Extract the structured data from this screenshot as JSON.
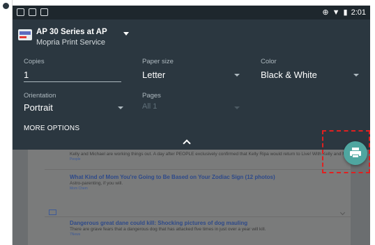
{
  "status_bar": {
    "time": "2:01",
    "left_icons": [
      "notification-icon",
      "notification-icon",
      "notification-icon"
    ],
    "right_icons": [
      "sync-icon",
      "wifi-icon",
      "battery-icon"
    ]
  },
  "printer": {
    "name": "AP 30 Series at AP",
    "service": "Mopria Print Service"
  },
  "options": {
    "copies_label": "Copies",
    "copies_value": "1",
    "paper_size_label": "Paper size",
    "paper_size_value": "Letter",
    "color_label": "Color",
    "color_value": "Black & White",
    "orientation_label": "Orientation",
    "orientation_value": "Portrait",
    "pages_label": "Pages",
    "pages_value": "All 1"
  },
  "more_options_label": "MORE OPTIONS",
  "preview": {
    "articles": [
      {
        "title": "",
        "body": "Kelly and Michael are working things out. A day after PEOPLE exclusively confirmed that Kelly Ripa would return to Live! With Kelly and Michael' after a nearly weeklong absence, a source says Michael Strahan is excited to have her",
        "tag": "People"
      },
      {
        "title": "What Kind of Mom You're Going to Be Based on Your Zodiac Sign (12 photos)",
        "body": "Astro-parenting, if you will.",
        "tag": "Mom Chem"
      },
      {
        "title": "Dangerous great dane could kill: Shocking pictures of dog mauling",
        "body": "There are grave fears that a dangerous dog that has attacked five times in just over a year will kill.",
        "tag": "7News"
      }
    ]
  },
  "colors": {
    "panel": "#2b3740",
    "fab": "#4fa6a0",
    "highlight": "#e02020"
  }
}
